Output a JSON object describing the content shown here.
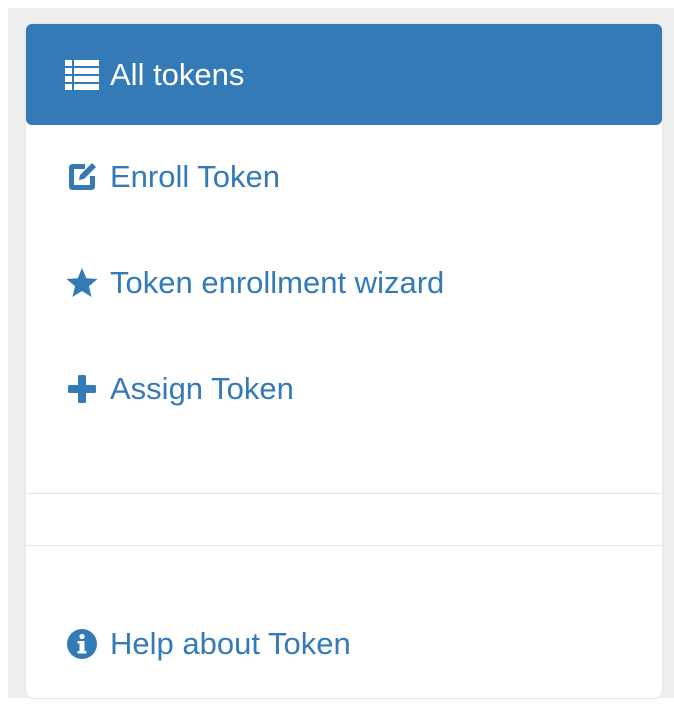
{
  "nav": {
    "items": [
      {
        "label": "All tokens",
        "icon": "list-icon",
        "active": true
      },
      {
        "label": "Enroll Token",
        "icon": "edit-icon",
        "active": false
      },
      {
        "label": "Token enrollment wizard",
        "icon": "star-icon",
        "active": false
      },
      {
        "label": "Assign Token",
        "icon": "plus-icon",
        "active": false
      }
    ],
    "help": {
      "label": "Help about Token",
      "icon": "info-circle-icon"
    }
  },
  "colors": {
    "accent": "#337ab7",
    "active_text": "#ffffff",
    "background": "#eeeeee",
    "panel": "#ffffff"
  }
}
